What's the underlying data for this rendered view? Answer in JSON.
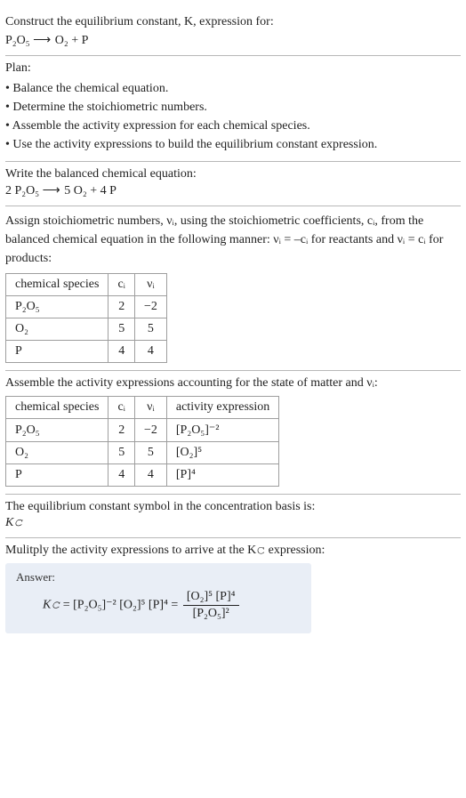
{
  "intro": {
    "line1": "Construct the equilibrium constant, K, expression for:",
    "eq_lhs": "P₂O₅",
    "arrow": "⟶",
    "eq_rhs": "O₂ + P"
  },
  "plan": {
    "heading": "Plan:",
    "items": [
      "• Balance the chemical equation.",
      "• Determine the stoichiometric numbers.",
      "• Assemble the activity expression for each chemical species.",
      "• Use the activity expressions to build the equilibrium constant expression."
    ]
  },
  "balanced": {
    "heading": "Write the balanced chemical equation:",
    "lhs": "2 P₂O₅",
    "arrow": "⟶",
    "rhs": "5 O₂ + 4 P"
  },
  "stoich": {
    "text_a": "Assign stoichiometric numbers, νᵢ, using the stoichiometric coefficients, cᵢ, from the balanced chemical equation in the following manner: νᵢ = –cᵢ for reactants and νᵢ = cᵢ for products:",
    "headers": {
      "species": "chemical species",
      "ci": "cᵢ",
      "vi": "νᵢ"
    },
    "rows": [
      {
        "species": "P₂O₅",
        "ci": "2",
        "vi": "−2"
      },
      {
        "species": "O₂",
        "ci": "5",
        "vi": "5"
      },
      {
        "species": "P",
        "ci": "4",
        "vi": "4"
      }
    ]
  },
  "activity": {
    "heading": "Assemble the activity expressions accounting for the state of matter and νᵢ:",
    "headers": {
      "species": "chemical species",
      "ci": "cᵢ",
      "vi": "νᵢ",
      "act": "activity expression"
    },
    "rows": [
      {
        "species": "P₂O₅",
        "ci": "2",
        "vi": "−2",
        "act": "[P₂O₅]⁻²"
      },
      {
        "species": "O₂",
        "ci": "5",
        "vi": "5",
        "act": "[O₂]⁵"
      },
      {
        "species": "P",
        "ci": "4",
        "vi": "4",
        "act": "[P]⁴"
      }
    ]
  },
  "basis": {
    "heading": "The equilibrium constant symbol in the concentration basis is:",
    "symbol": "K𝚌"
  },
  "multiply": {
    "heading": "Mulitply the activity expressions to arrive at the K𝚌 expression:"
  },
  "answer": {
    "label": "Answer:",
    "kc": "K𝚌",
    "eq": "=",
    "term1": "[P₂O₅]⁻²",
    "term2": "[O₂]⁵",
    "term3": "[P]⁴",
    "frac_num": "[O₂]⁵ [P]⁴",
    "frac_den": "[P₂O₅]²"
  },
  "chart_data": {
    "type": "table",
    "tables": [
      {
        "title": "Stoichiometric numbers",
        "columns": [
          "chemical species",
          "c_i",
          "v_i"
        ],
        "rows": [
          [
            "P2O5",
            2,
            -2
          ],
          [
            "O2",
            5,
            5
          ],
          [
            "P",
            4,
            4
          ]
        ]
      },
      {
        "title": "Activity expressions",
        "columns": [
          "chemical species",
          "c_i",
          "v_i",
          "activity expression"
        ],
        "rows": [
          [
            "P2O5",
            2,
            -2,
            "[P2O5]^-2"
          ],
          [
            "O2",
            5,
            5,
            "[O2]^5"
          ],
          [
            "P",
            4,
            4,
            "[P]^4"
          ]
        ]
      }
    ]
  }
}
